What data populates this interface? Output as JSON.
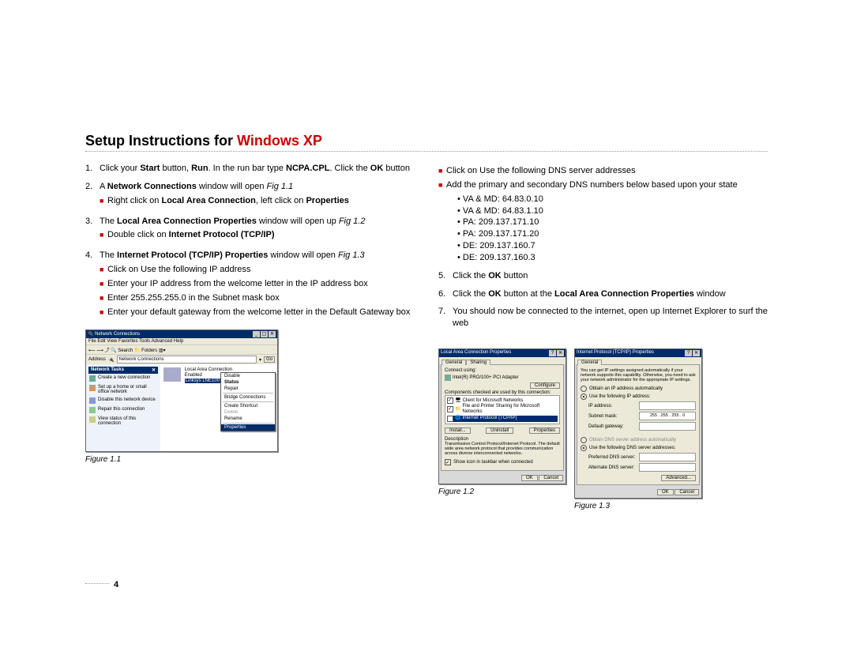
{
  "page_number": "4",
  "title_prefix": "Setup Instructions for ",
  "title_suffix": "Windows XP",
  "left_steps": {
    "s1": "Click your <b>Start</b> button, <b>Run</b>. In the run bar type <b>NCPA.CPL</b>. Click the <b>OK</b> button",
    "s2": "A <b>Network Connections</b> window will open <i>Fig 1.1</i>",
    "s2b1": "Right click on <b>Local Area Connection</b>, left click on <b>Properties</b>",
    "s3": "The <b>Local Area Connection Properties</b> window will open up <i>Fig 1.2</i>",
    "s3b1": "Double click on <b>Internet Protocol (TCP/IP)</b>",
    "s4": "The <b>Internet Protocol (TCP/IP) Properties</b> window will open <i>Fig 1.3</i>",
    "s4b1": "Click on Use the following IP address",
    "s4b2": "Enter your IP address from the welcome letter in the IP address box",
    "s4b3": "Enter 255.255.255.0 in the Subnet mask box",
    "s4b4": "Enter your default gateway from the welcome letter in the Default Gateway box"
  },
  "right_steps": {
    "rb1": "Click on Use the following DNS server addresses",
    "rb2": "Add the primary and secondary DNS numbers below based upon your state",
    "dns": [
      "VA & MD: 64.83.0.10",
      "VA & MD: 64.83.1.10",
      "PA: 209.137.171.10",
      "PA: 209.137.171.20",
      "DE: 209.137.160.7",
      "DE: 209.137.160.3"
    ],
    "s5": "Click the <b>OK</b> button",
    "s6": "Click the <b>OK</b> button at the <b>Local Area Connection Properties</b> window",
    "s7": "You should now be connected to the internet, open up Internet Explorer to surf the web"
  },
  "fig_captions": {
    "f1": "Figure 1.1",
    "f2": "Figure 1.2",
    "f3": "Figure 1.3"
  },
  "shot1": {
    "title": "Network Connections",
    "menu": "File   Edit   View   Favorites   Tools   Advanced   Help",
    "toolbar": "⟵   ⟶   ⤴   🔍 Search   📁 Folders   ▥▾",
    "addrlabel": "Address",
    "addrvalue": "Network Connections",
    "go": "Go",
    "tasks_header": "Network Tasks",
    "tasks": [
      "Create a new connection",
      "Set up a home or small office network",
      "Disable this network device",
      "Repair this connection",
      "View status of this connection"
    ],
    "lac_name": "Local Area Connection",
    "lac_status": "Enabled",
    "lac_adapter": "Linksys LNE100TX Fast Ethern...",
    "ctx": {
      "disable": "Disable",
      "status": "Status",
      "repair": "Repair",
      "bridge": "Bridge Connections",
      "shortcut": "Create Shortcut",
      "delete": "Delete",
      "rename": "Rename",
      "properties": "Properties"
    }
  },
  "shot2": {
    "title": "Local Area Connection Properties",
    "tab_general": "General",
    "tab_sharing": "Sharing",
    "connect_using": "Connect using:",
    "adapter": "Intel(R) PRO/100+ PCI Adapter",
    "configure": "Configure",
    "components_label": "Components checked are used by this connection:",
    "comp1": "Client for Microsoft Networks",
    "comp2": "File and Printer Sharing for Microsoft Networks",
    "comp3": "Internet Protocol (TCP/IP)",
    "install": "Install...",
    "uninstall": "Uninstall",
    "properties": "Properties",
    "desc_label": "Description",
    "desc_text": "Transmission Control Protocol/Internet Protocol. The default wide area network protocol that provides communication across diverse interconnected networks.",
    "showicon": "Show icon in taskbar when connected",
    "ok": "OK",
    "cancel": "Cancel"
  },
  "shot3": {
    "title": "Internet Protocol (TCP/IP) Properties",
    "tab_general": "General",
    "intro": "You can get IP settings assigned automatically if your network supports this capability. Otherwise, you need to ask your network administrator for the appropriate IP settings.",
    "opt_auto": "Obtain an IP address automatically",
    "opt_manual": "Use the following IP address:",
    "ip_label": "IP address:",
    "subnet_label": "Subnet mask:",
    "subnet_value": "255 . 255 . 255 .  0",
    "gateway_label": "Default gateway:",
    "dns_auto": "Obtain DNS server address automatically",
    "dns_manual": "Use the following DNS server addresses:",
    "pref_dns": "Preferred DNS server:",
    "alt_dns": "Alternate DNS server:",
    "advanced": "Advanced...",
    "ok": "OK",
    "cancel": "Cancel"
  }
}
